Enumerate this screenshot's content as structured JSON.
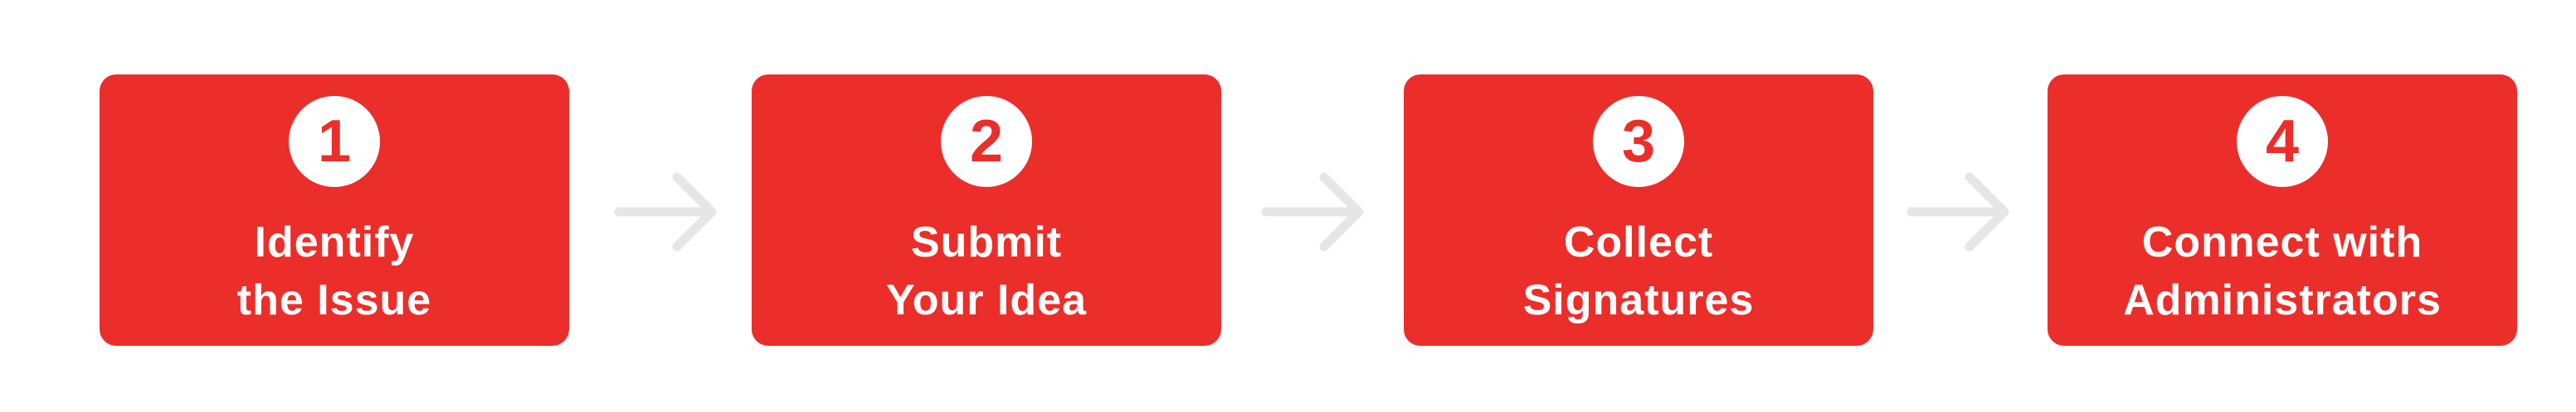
{
  "steps": [
    {
      "number": "1",
      "line1": "Identify",
      "line2": "the Issue"
    },
    {
      "number": "2",
      "line1": "Submit",
      "line2": "Your Idea"
    },
    {
      "number": "3",
      "line1": "Collect",
      "line2": "Signatures"
    },
    {
      "number": "4",
      "line1": "Connect with",
      "line2": "Administrators"
    }
  ],
  "colors": {
    "box": "#eb2e2a",
    "badge": "#ffffff",
    "text": "#ffffff",
    "arrow": "#e6e6e6"
  },
  "icons": {
    "connector": "right-arrow-icon"
  }
}
